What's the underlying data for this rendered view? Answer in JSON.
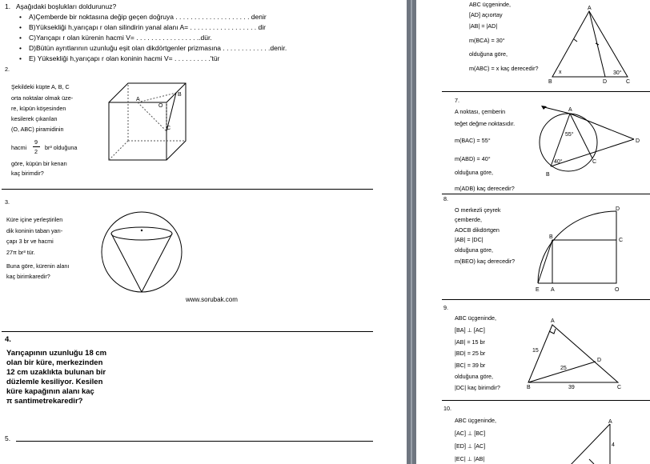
{
  "q1": {
    "num": "1.",
    "title": "Aşağıdaki boşlukları doldurunuz?",
    "items": [
      "A)Çemberde bir noktasına  değip geçen doğruya . . . . . . . . . . . . . . . . . . . . denir",
      "B)Yüksekliği h,yarıçapı r olan silindirin  yanal alanı    A= . . . . . . . . . . . . . . . . . .  dir",
      "C)Yarıçapı r olan kürenin hacmi   V= . . . . . . .  . . . . . . . . . ..dür.",
      "D)Bütün ayrıtlarının uzunluğu  eşit olan dikdörtgenler  prizmasına . . . . . . . .  . . . . .denir.",
      "E) Yüksekliği h,yarıçapı r olan koninin hacmi  V=     . . . . . . . . . .'tür"
    ]
  },
  "q2": {
    "num": "2.",
    "lines": [
      "Şekildeki küpte A, B, C",
      "orta noktalar olmak üze-",
      "re, küpün köşesinden",
      "kesilerek çıkarılan",
      "(O, ABC) piramidinin"
    ],
    "vol_pre": "hacmi",
    "frac_num": "9",
    "frac_den": "2",
    "vol_post": "br³ olduğuna",
    "lines2": [
      "göre, küpün bir kenarı",
      "kaç birimdir?"
    ],
    "labels": {
      "A": "A",
      "B": "B",
      "C": "C",
      "O": "O"
    }
  },
  "q3": {
    "num": "3.",
    "lines": [
      "Küre içine yerleştirilen",
      "dik koninin taban yarı-",
      "çapı 3 br ve hacmi",
      "27π br³ tür.",
      "Buna göre, kürenin alanı",
      "kaç birimkaredir?"
    ],
    "watermark": "www.sorubak.com"
  },
  "q4": {
    "num": "4.",
    "lines": [
      "Yarıçapının uzunluğu 18 cm",
      "olan bir küre, merkezinden",
      "12 cm uzaklıkta bulunan bir",
      "düzlemle kesiliyor. Kesilen",
      "küre kapağının alanı kaç",
      "π  santimetrekaredir?"
    ]
  },
  "q5": {
    "num": "5."
  },
  "r6": {
    "lines": [
      "ABC üçgeninde,",
      "[AD] açıortay",
      "|AB| = |AD|",
      "m(BCA) = 30°",
      "olduğuna göre,",
      "m(ABC) = x kaç derecedir?"
    ],
    "labels": {
      "A": "A",
      "B": "B",
      "C": "C",
      "D": "D",
      "x": "x",
      "ang": "30°"
    }
  },
  "r7": {
    "num": "7.",
    "lines": [
      "A noktası, çemberin",
      "teğet değme noktasıdır.",
      "m(BAC) = 55°",
      "m(ABD) = 40°",
      "olduğuna göre,",
      "m(ADB) kaç derecedir?"
    ],
    "labels": {
      "A": "A",
      "B": "B",
      "C": "C",
      "D": "D",
      "a1": "55°",
      "a2": "40°"
    }
  },
  "r8": {
    "num": "8.",
    "lines": [
      "O merkezli çeyrek",
      "çemberde,",
      "AOCB dikdörtgen",
      "|AB| = |DC|",
      "olduğuna göre,",
      "m(BEO) kaç derecedir?"
    ],
    "labels": {
      "B": "B",
      "C": "C",
      "D": "D",
      "E": "E",
      "A": "A",
      "O": "O"
    }
  },
  "r9": {
    "num": "9.",
    "lines": [
      "ABC üçgeninde,",
      "[BA] ⊥ [AC]",
      "|AB| = 15 br",
      "|BD| = 25 br",
      "|BC| = 39 br",
      "olduğuna göre,",
      "|DC| kaç birimdir?"
    ],
    "labels": {
      "A": "A",
      "B": "B",
      "C": "C",
      "D": "D",
      "n15": "15",
      "n25": "25",
      "n39": "39"
    }
  },
  "r10": {
    "num": "10.",
    "lines": [
      "ABC üçgeninde,",
      "[AC] ⊥ [BC]",
      "[ED] ⊥ [AC]",
      "|EC| ⊥ |AB|"
    ],
    "labels": {
      "A": "A",
      "n4": "4"
    }
  }
}
